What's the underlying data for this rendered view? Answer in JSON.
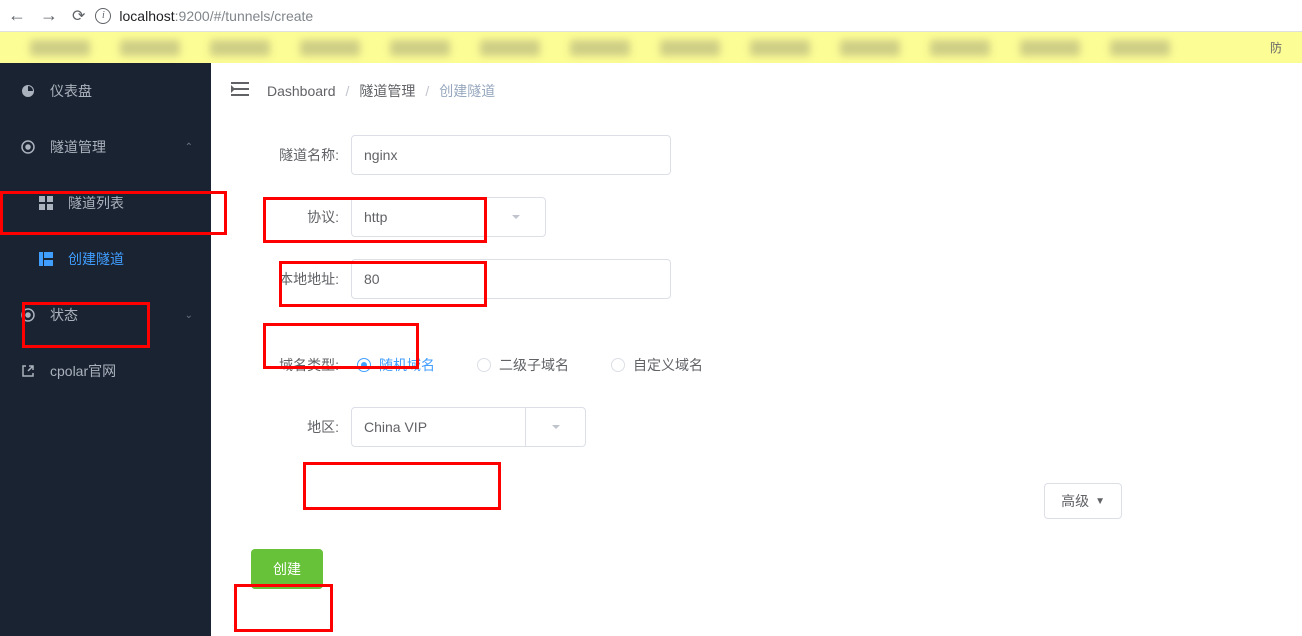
{
  "browser": {
    "url_host": "localhost",
    "url_path": ":9200/#/tunnels/create",
    "bookmark_right": "防"
  },
  "sidebar": {
    "dashboard": "仪表盘",
    "tunnel_mgmt": "隧道管理",
    "tunnel_list": "隧道列表",
    "tunnel_create": "创建隧道",
    "status": "状态",
    "cpolar_site": "cpolar官网"
  },
  "breadcrumb": {
    "dashboard": "Dashboard",
    "tunnel_mgmt": "隧道管理",
    "tunnel_create": "创建隧道"
  },
  "form": {
    "tunnel_name_label": "隧道名称:",
    "tunnel_name_value": "nginx",
    "protocol_label": "协议:",
    "protocol_value": "http",
    "local_addr_label": "本地地址:",
    "local_addr_value": "80",
    "domain_type_label": "域名类型:",
    "domain_random": "随机域名",
    "domain_sub": "二级子域名",
    "domain_custom": "自定义域名",
    "region_label": "地区:",
    "region_value": "China VIP",
    "advanced_label": "高级",
    "submit_label": "创建"
  }
}
